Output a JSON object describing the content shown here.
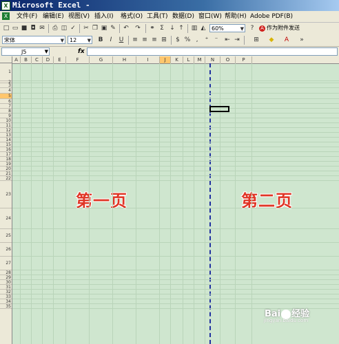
{
  "window": {
    "title": "Microsoft Excel -",
    "app_icon": "excel-icon"
  },
  "menu": {
    "items": [
      "文件(F)",
      "编辑(E)",
      "视图(V)",
      "插入(I)",
      "格式(O)",
      "工具(T)",
      "数据(D)",
      "窗口(W)",
      "帮助(H)",
      "Adobe PDF(B)"
    ]
  },
  "toolbar": {
    "zoom": "60%",
    "pdf_action": "作为附件发送",
    "font_name": "宋体",
    "font_size": "12"
  },
  "formula_bar": {
    "name_box": "J5",
    "fx_label": "fx",
    "formula": ""
  },
  "sheet": {
    "columns": [
      "A",
      "B",
      "C",
      "D",
      "E",
      "F",
      "G",
      "H",
      "I",
      "J",
      "K",
      "L",
      "M",
      "N",
      "O",
      "P"
    ],
    "active_column": "J",
    "rows": [
      "1",
      "2",
      "3",
      "4",
      "5",
      "6",
      "7",
      "8",
      "9",
      "10",
      "11",
      "12",
      "13",
      "14",
      "15",
      "16",
      "17",
      "18",
      "19",
      "20",
      "21",
      "22",
      "23",
      "24",
      "25",
      "26",
      "27",
      "28",
      "29",
      "30",
      "31",
      "32",
      "33",
      "34",
      "35"
    ],
    "active_row": "5",
    "page_labels": [
      "第一页",
      "第二页"
    ]
  },
  "watermark": {
    "text": "Bai",
    "suffix": "经验",
    "sub": "jingyan.baidu.com"
  }
}
